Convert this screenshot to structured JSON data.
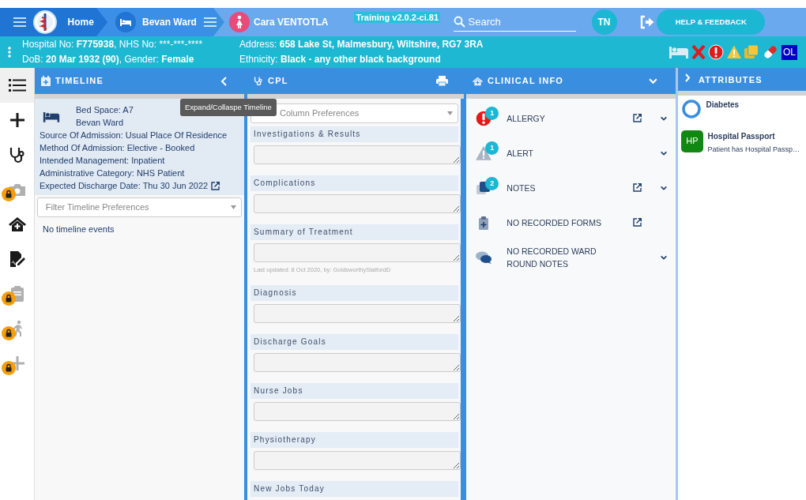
{
  "nav": {
    "home_label": "Home",
    "ward_label": "Bevan Ward",
    "patient_name": "Cara VENTOTLA",
    "version": "Training v2.0.2-ci.81",
    "search": {
      "placeholder": "Search"
    },
    "user_initials": "TN",
    "help_button": "HELP & FEEDBACK"
  },
  "banner": {
    "left_lines": [
      [
        {
          "text": "Hospital No: ",
          "bold": false
        },
        {
          "text": "F775938",
          "bold": true
        },
        {
          "text": ", NHS No: ***-***-****",
          "bold": false
        }
      ],
      [
        {
          "text": "DoB: ",
          "bold": false
        },
        {
          "text": "20 Mar 1932 (90)",
          "bold": true
        },
        {
          "text": ", Gender: ",
          "bold": false
        },
        {
          "text": "Female",
          "bold": true
        }
      ]
    ],
    "right_lines": [
      [
        {
          "text": "Address: ",
          "bold": false
        },
        {
          "text": "658 Lake St, Malmesbury, Wiltshire, RG7 3RA",
          "bold": true
        }
      ],
      [
        {
          "text": "Ethnicity: ",
          "bold": false
        },
        {
          "text": "Black - any other black background",
          "bold": true
        }
      ]
    ],
    "flags": [
      {
        "kind": "bed"
      },
      {
        "kind": "cross"
      },
      {
        "kind": "allergy"
      },
      {
        "kind": "alert"
      },
      {
        "kind": "notes"
      },
      {
        "kind": "medication"
      },
      {
        "kind": "label",
        "text": "OL"
      }
    ]
  },
  "sidebar": {
    "items": [
      {
        "kind": "list",
        "selected": true,
        "locked": false
      },
      {
        "kind": "plus",
        "selected": false,
        "locked": false
      },
      {
        "kind": "stethoscope",
        "selected": false,
        "locked": false
      },
      {
        "kind": "camera",
        "selected": false,
        "locked": true
      },
      {
        "kind": "home",
        "selected": false,
        "locked": false
      },
      {
        "kind": "document",
        "selected": false,
        "locked": false
      },
      {
        "kind": "clipboard",
        "selected": false,
        "locked": true
      },
      {
        "kind": "walking",
        "selected": false,
        "locked": true
      },
      {
        "kind": "plus",
        "selected": false,
        "locked": true
      }
    ]
  },
  "timeline": {
    "title": "TIMELINE",
    "tooltip": "Expand/Collaspe Timeline",
    "bed_space": "Bed Space: A7",
    "ward": "Bevan Ward",
    "details": [
      {
        "text": "Source Of Admission: Usual Place Of Residence",
        "link": false
      },
      {
        "text": "Method Of Admission: Elective - Booked",
        "link": false
      },
      {
        "text": "Intended Management: Inpatient",
        "link": false
      },
      {
        "text": "Administrative Category: NHS Patient",
        "link": false
      },
      {
        "text": "Expected Discharge Date: Thu 30 Jun 2022",
        "link": true
      }
    ],
    "filter": {
      "placeholder": "Filter Timeline Preferences"
    },
    "empty_text": "No timeline events"
  },
  "cpl": {
    "title": "CPL",
    "preferences": {
      "placeholder": "Column Preferences"
    },
    "sections": [
      {
        "title": "Investigations & Results",
        "field": true
      },
      {
        "title": "Complications",
        "field": true
      },
      {
        "title": "Summary of Treatment",
        "field": true,
        "note": "Last updated: 8 Oct 2020, by: GoldsworthySlatfordD"
      },
      {
        "title": "Diagnosis",
        "field": true
      },
      {
        "title": "Discharge Goals",
        "field": true
      },
      {
        "title": "Nurse Jobs",
        "field": true
      },
      {
        "title": "Physiotherapy",
        "field": true
      },
      {
        "title": "New Jobs Today",
        "field": false
      }
    ]
  },
  "clinical_info": {
    "title": "CLINICAL INFO",
    "rows": [
      {
        "kind": "allergy",
        "label": "ALLERGY",
        "count": "1",
        "link": true,
        "expandable": true
      },
      {
        "kind": "alert",
        "label": "ALERT",
        "count": "1",
        "link": false,
        "expandable": true
      },
      {
        "kind": "notes",
        "label": "NOTES",
        "count": "2",
        "link": true,
        "expandable": true
      },
      {
        "kind": "forms",
        "label": "NO RECORDED FORMS",
        "link": true,
        "expandable": false
      },
      {
        "kind": "ward_round",
        "label": "NO RECORDED WARD ROUND NOTES",
        "link": false,
        "expandable": true
      }
    ]
  },
  "attributes": {
    "title": "ATTRIBUTES",
    "items": [
      {
        "kind": "ring",
        "title": "Diabetes"
      },
      {
        "kind": "badge",
        "badge": "HP",
        "title": "Hospital Passport",
        "subtitle": "Patient has Hospital Passp…"
      }
    ]
  }
}
